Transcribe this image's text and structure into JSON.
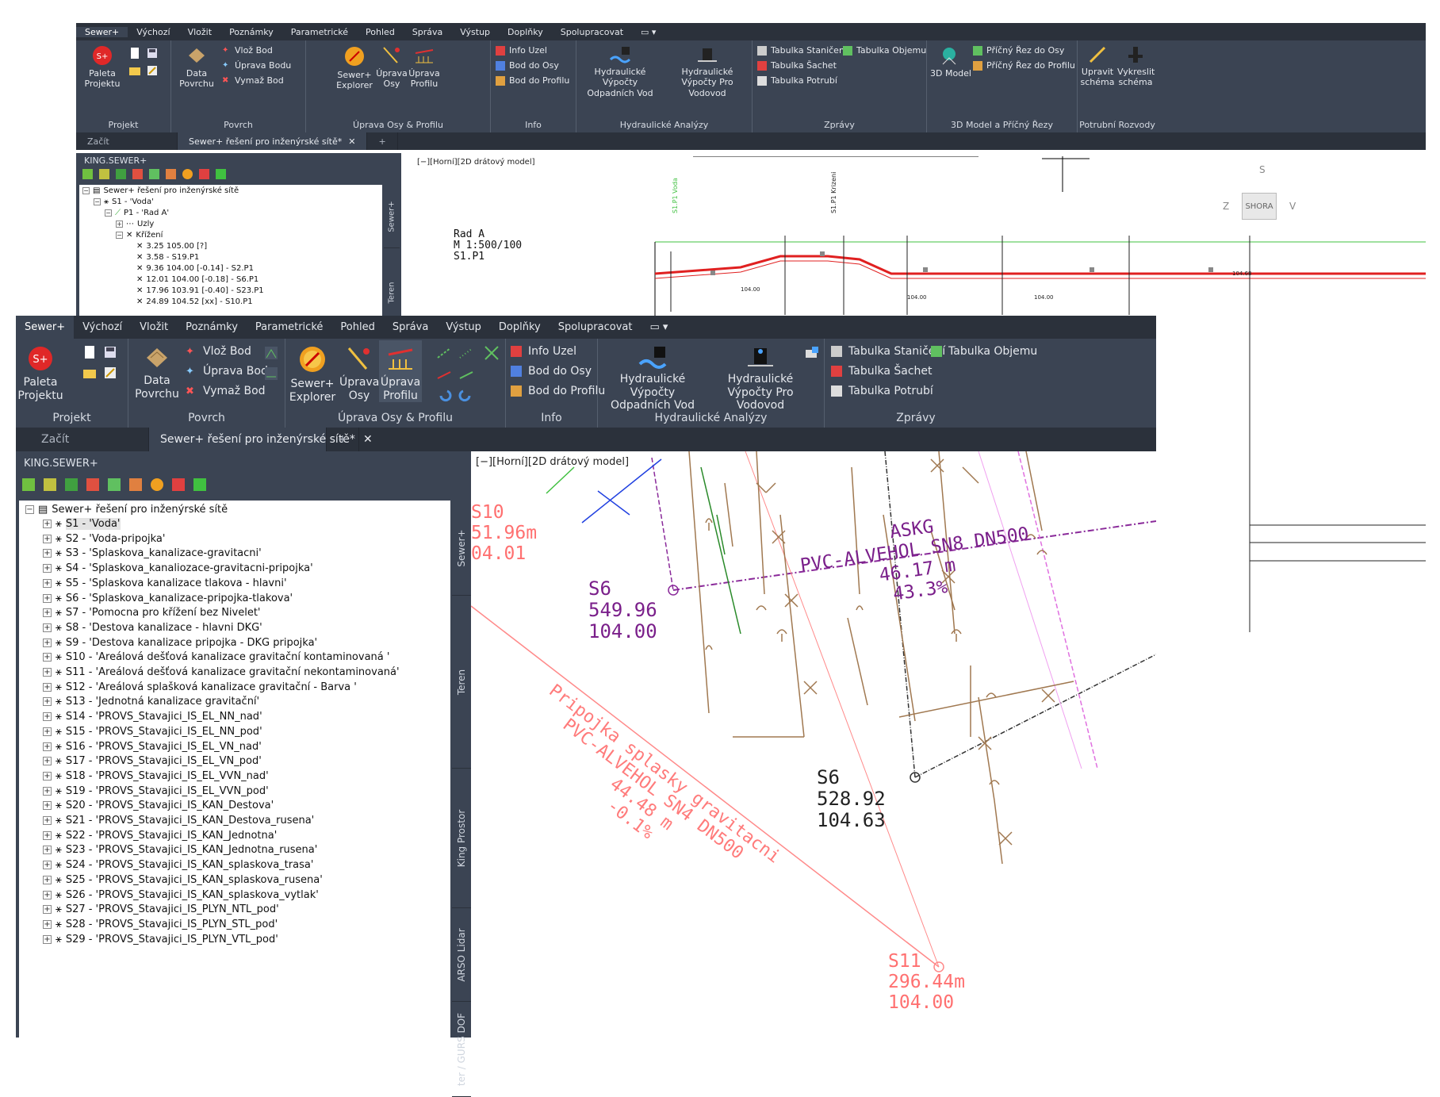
{
  "menu": [
    "Sewer+",
    "Výchozí",
    "Vložit",
    "Poznámky",
    "Parametrické",
    "Pohled",
    "Správa",
    "Výstup",
    "Doplňky",
    "Spolupracovat"
  ],
  "ribbon": {
    "projekt": {
      "label": "Projekt",
      "paleta": "Paleta Projektu"
    },
    "povrch": {
      "label": "Povrch",
      "data": "Data Povrchu",
      "vloz": "Vlož Bod",
      "uprava": "Úprava Bodu",
      "vymaz": "Vymaž Bod"
    },
    "osy": {
      "label": "Úprava Osy & Profilu",
      "explorer": "Sewer+ Explorer",
      "uprava_osy": "Úprava Osy",
      "uprava_profilu": "Úprava Profilu"
    },
    "info": {
      "label": "Info",
      "uzel": "Info Uzel",
      "bod_osy": "Bod do Osy",
      "bod_profilu": "Bod do Profilu"
    },
    "hydraulika": {
      "label": "Hydraulické Analýzy",
      "odpadni": "Hydraulické Výpočty Odpadních Vod",
      "vodovod": "Hydraulické Výpočty Pro Vodovod"
    },
    "zpravy": {
      "label": "Zprávy",
      "stanice": "Tabulka Staničení",
      "objem": "Tabulka Objemu",
      "sachet": "Tabulka Šachet",
      "potrubi": "Tabulka Potrubí"
    },
    "model3d": {
      "label": "3D Model a Příčný Řezy",
      "model": "3D Model",
      "rez_osy": "Příčný Řez do Osy",
      "rez_profilu": "Příčný Řez do Profilu"
    },
    "rozvody": {
      "label": "Potrubní Rozvody",
      "upravit": "Upravit schéma",
      "vykreslit": "Vykreslit schéma"
    }
  },
  "tabs": {
    "start": "Začít",
    "doc": "Sewer+ řešení pro inženýrské sítě*"
  },
  "panel_title": "KING.SEWER+",
  "viewport_label": "[−][Horní][2D drátový model]",
  "back_tree": [
    "Sewer+ řešení pro inženýrské sítě",
    "S1 - 'Voda'",
    "P1 - 'Rad A'",
    "Uzly",
    "Křížení",
    "3.25 105.00 [?]",
    "3.58 - S19.P1",
    "9.36 104.00 [-0.14] - S2.P1",
    "12.01 104.00 [-0.18] - S6.P1",
    "17.96 103.91 [-0.40] - S23.P1",
    "24.89 104.52 [xx] - S10.P1"
  ],
  "tree_root": "Sewer+ řešení pro inženýrské sítě",
  "tree_items": [
    "S1 - 'Voda'",
    "S2 - 'Voda-pripojka'",
    "S3 - 'Splaskova_kanalizace-gravitacni'",
    "S4 - 'Splaskova_kanaliozace-gravitacni-pripojka'",
    "S5 - 'Splaskova kanalizace tlakova - hlavni'",
    "S6 - 'Splaskova_kanalizace-pripojka-tlakova'",
    "S7 - 'Pomocna pro křížení bez Nivelet'",
    "S8 - 'Destova kanalizace - hlavni DKG'",
    "S9 - 'Destova kanalizace pripojka - DKG pripojka'",
    "S10 - 'Areálová dešťová kanalizace gravitační kontaminovaná '",
    "S11 - 'Areálová dešťová kanalizace gravitační nekontaminovaná'",
    "S12 - 'Areálová splašková kanalizace gravitační - Barva '",
    "S13 - 'Jednotná kanalizace gravitační'",
    "S14 - 'PROVS_Stavajici_IS_EL_NN_nad'",
    "S15 - 'PROVS_Stavajici_IS_EL_NN_pod'",
    "S16 - 'PROVS_Stavajici_IS_EL_VN_nad'",
    "S17 - 'PROVS_Stavajici_IS_EL_VN_pod'",
    "S18 - 'PROVS_Stavajici_IS_EL_VVN_nad'",
    "S19 - 'PROVS_Stavajici_IS_EL_VVN_pod'",
    "S20 - 'PROVS_Stavajici_IS_KAN_Destova'",
    "S21 - 'PROVS_Stavajici_IS_KAN_Destova_rusena'",
    "S22 - 'PROVS_Stavajici_IS_KAN_Jednotna'",
    "S23 - 'PROVS_Stavajici_IS_KAN_Jednotna_rusena'",
    "S24 - 'PROVS_Stavajici_IS_KAN_splaskova_trasa'",
    "S25 - 'PROVS_Stavajici_IS_KAN_splaskova_rusena'",
    "S26 - 'PROVS_Stavajici_IS_KAN_splaskova_vytlak'",
    "S27 - 'PROVS_Stavajici_IS_PLYN_NTL_pod'",
    "S28 - 'PROVS_Stavajici_IS_PLYN_STL_pod'",
    "S29 - 'PROVS_Stavajici_IS_PLYN_VTL_pod'"
  ],
  "side_tabs": [
    "Sewer+",
    "Teren",
    "King Prostor",
    "ARSO Lidar",
    "ter / GURS DOF"
  ],
  "back_side_tabs": [
    "Sewer+",
    "Teren"
  ],
  "profile": {
    "title": "Rad A",
    "scale": "M 1:500/100",
    "id": "S1.P1"
  },
  "viewcube": {
    "top": "SHORA",
    "n": "S",
    "w": "Z",
    "e": "V"
  },
  "plan": {
    "s10": {
      "name": "S10",
      "l1": "51.96m",
      "l2": "04.01"
    },
    "s6a": {
      "name": "S6",
      "l1": "549.96",
      "l2": "104.00"
    },
    "s6b": {
      "name": "S6",
      "l1": "528.92",
      "l2": "104.63"
    },
    "s11": {
      "name": "S11",
      "l1": "296.44m",
      "l2": "104.00"
    },
    "askg": {
      "l0": "ASKG",
      "l1": "PVC-ALVEHOL SN8 DN500",
      "l2": "46.17 m",
      "l3": "43.3%"
    },
    "pripojka": {
      "l1": "Pripojka splasky gravitacni",
      "l2": "PVC-ALVEHOL SN4 DN500",
      "l3": "44.48 m",
      "l4": "-0.1%"
    }
  },
  "colors": {
    "dark": "#3b4453",
    "darker": "#2b313b",
    "purple": "#7a1f8a",
    "salmon": "#ff7b7b",
    "brown": "#a07850",
    "magenta": "#e070e0",
    "red": "#e02020"
  }
}
